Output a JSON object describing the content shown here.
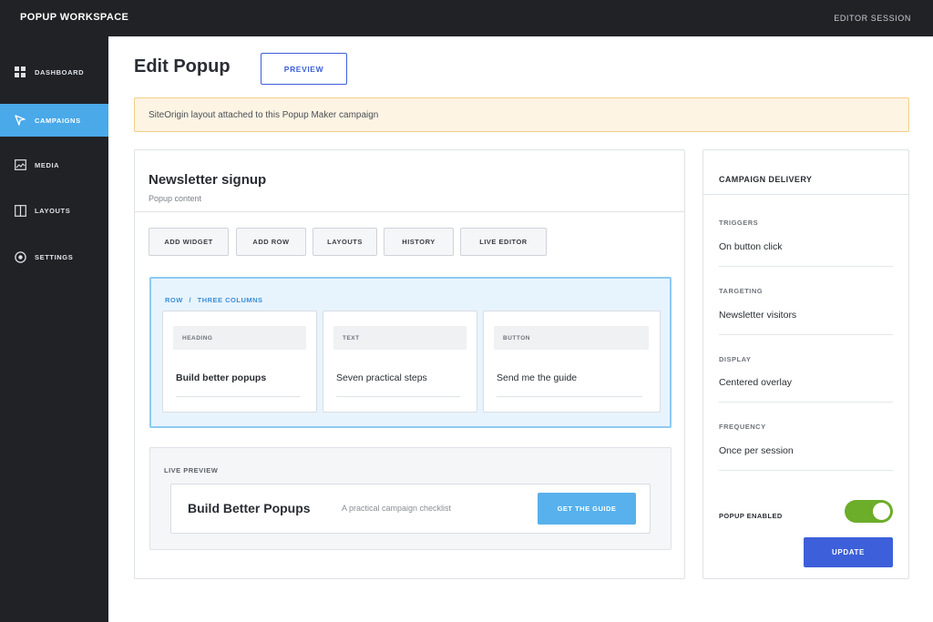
{
  "app": {
    "brand": "POPUP WORKSPACE",
    "session": "EDITOR SESSION"
  },
  "sidebar": {
    "items": [
      {
        "label": "DASHBOARD",
        "icon": "grid-icon",
        "active": false
      },
      {
        "label": "CAMPAIGNS",
        "icon": "megaphone-icon",
        "active": true
      },
      {
        "label": "MEDIA",
        "icon": "image-icon",
        "active": false
      },
      {
        "label": "LAYOUTS",
        "icon": "columns-icon",
        "active": false
      },
      {
        "label": "SETTINGS",
        "icon": "target-icon",
        "active": false
      }
    ]
  },
  "header": {
    "title": "Edit Popup",
    "preview_label": "PREVIEW"
  },
  "notice": {
    "text": "SiteOrigin layout attached to this Popup Maker campaign"
  },
  "editor": {
    "title": "Newsletter signup",
    "subtitle": "Popup content",
    "toolbar": [
      "ADD WIDGET",
      "ADD ROW",
      "LAYOUTS",
      "HISTORY",
      "LIVE EDITOR"
    ],
    "row": {
      "crumb": [
        "ROW",
        "/",
        "THREE COLUMNS"
      ],
      "columns": [
        {
          "tag": "HEADING",
          "text": "Build better popups"
        },
        {
          "tag": "TEXT",
          "text": "Seven practical steps"
        },
        {
          "tag": "BUTTON",
          "text": "Send me the guide"
        }
      ]
    },
    "preview": {
      "label": "LIVE PREVIEW",
      "title": "Build Better Popups",
      "subtitle": "A practical campaign checklist",
      "button": "GET THE GUIDE"
    }
  },
  "delivery": {
    "title": "CAMPAIGN DELIVERY",
    "settings": [
      {
        "label": "TRIGGERS",
        "value": "On button click"
      },
      {
        "label": "TARGETING",
        "value": "Newsletter visitors"
      },
      {
        "label": "DISPLAY",
        "value": "Centered overlay"
      },
      {
        "label": "FREQUENCY",
        "value": "Once per session"
      }
    ],
    "toggle_label": "POPUP ENABLED",
    "toggle_on": true,
    "update_label": "UPDATE"
  },
  "colors": {
    "accent": "#3d5fd9",
    "active_nav": "#4aa9e8",
    "toggle_on": "#6cad2a",
    "sidebar_bg": "#202226",
    "notice_bg": "#fdf4e4"
  }
}
